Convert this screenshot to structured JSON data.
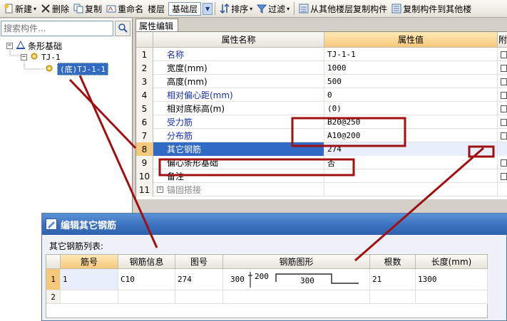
{
  "toolbar": {
    "new_label": "新建",
    "delete_label": "删除",
    "copy_label": "复制",
    "rename_label": "重命名",
    "floor_label": "楼层",
    "floor_value": "基础层",
    "sort_label": "排序",
    "filter_label": "过滤",
    "copy_from_floor_label": "从其他楼层复制构件",
    "copy_to_floor_label": "复制构件到其他楼"
  },
  "search": {
    "placeholder": "搜索构件..."
  },
  "tree": {
    "root_label": "条形基础",
    "child_label": "TJ-1",
    "selected_label": "(底)TJ-1-1"
  },
  "property_tab": "属性编辑",
  "property_grid": {
    "col_name": "属性名称",
    "col_value": "属性值",
    "col_extra": "附",
    "rows": [
      {
        "num": "1",
        "name": "名称",
        "value": "TJ-1-1"
      },
      {
        "num": "2",
        "name": "宽度(mm)",
        "value": "1000"
      },
      {
        "num": "3",
        "name": "高度(mm)",
        "value": "500"
      },
      {
        "num": "4",
        "name": "相对偏心距(mm)",
        "value": "0"
      },
      {
        "num": "5",
        "name": "相对底标高(m)",
        "value": "(0)"
      },
      {
        "num": "6",
        "name": "受力筋",
        "value": "B20@250"
      },
      {
        "num": "7",
        "name": "分布筋",
        "value": "A10@200"
      },
      {
        "num": "8",
        "name": "其它钢筋",
        "value": "274"
      },
      {
        "num": "9",
        "name": "偏心条形基础",
        "value": "否"
      },
      {
        "num": "10",
        "name": "备注",
        "value": ""
      },
      {
        "num": "11",
        "name": "锚固搭接",
        "value": ""
      }
    ]
  },
  "dialog": {
    "title": "编辑其它钢筋",
    "list_label": "其它钢筋列表:",
    "headers": [
      "筋号",
      "钢筋信息",
      "图号",
      "钢筋图形",
      "根数",
      "长度(mm)"
    ],
    "rows": [
      {
        "num": "1",
        "bar_no": "1",
        "info": "C10",
        "fig_no": "274",
        "shape_left": "300",
        "shape_hook": "200",
        "shape_mid": "300",
        "count": "21",
        "length": "1300"
      },
      {
        "num": "2",
        "bar_no": "",
        "info": "",
        "fig_no": "",
        "shape_left": "",
        "shape_hook": "",
        "shape_mid": "",
        "count": "",
        "length": ""
      }
    ]
  },
  "colors": {
    "annotation": "#a01010",
    "selection": "#316ac5",
    "header_highlight": "#f6c87a",
    "title_bar": "#3a70bd"
  }
}
